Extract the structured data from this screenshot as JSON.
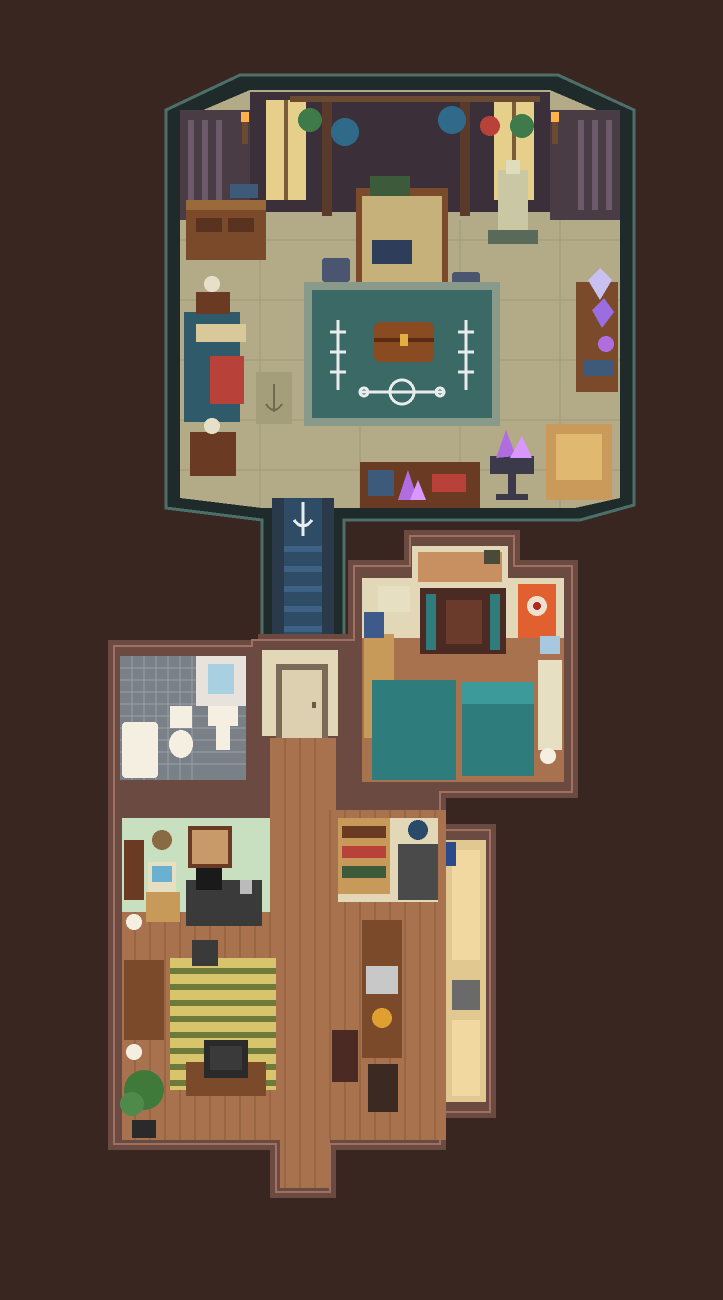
{
  "scene": {
    "background": "#3a2620",
    "palette": {
      "wall_dark": "#1e2b2a",
      "wall_teal": "#33514c",
      "stone_floor": "#b3ab88",
      "stone_floor_dark": "#8f8966",
      "rug_teal": "#3b6a66",
      "rug_border": "#8a9a8a",
      "rune_white": "#e8ecec",
      "wood_floor": "#a8724e",
      "wood_floor_dark": "#8a5a3a",
      "house_wall": "#6b4a42",
      "house_wall_light": "#a07060",
      "bed_teal": "#2f7c7c",
      "crystal_purple": "#b06de0",
      "tile_white": "#e7e3dc",
      "tile_grey": "#7a8088",
      "stripe_yellow": "#d8c46a",
      "stripe_green": "#6d7a3c"
    }
  },
  "rooms": [
    {
      "id": "ritual-chamber",
      "type": "stone"
    },
    {
      "id": "stairway",
      "type": "passage"
    },
    {
      "id": "bathroom",
      "type": "tile"
    },
    {
      "id": "hallway",
      "type": "wood"
    },
    {
      "id": "bedroom",
      "type": "wood"
    },
    {
      "id": "living-kitchen",
      "type": "wood"
    }
  ],
  "objects": [
    {
      "name": "crystal-cluster-icon",
      "kind": "crystal"
    },
    {
      "name": "rune-symbol-icon",
      "kind": "rune"
    },
    {
      "name": "skeleton-statue-icon",
      "kind": "statue"
    },
    {
      "name": "door-icon",
      "kind": "door"
    },
    {
      "name": "tv-icon",
      "kind": "television"
    },
    {
      "name": "plant-icon",
      "kind": "plant"
    }
  ]
}
